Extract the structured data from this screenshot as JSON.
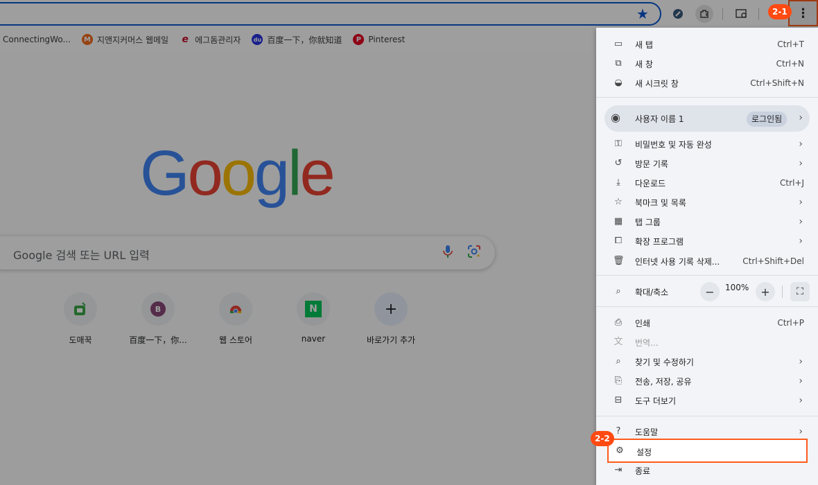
{
  "toolbar": {
    "menu_icon": "more-vert-icon"
  },
  "bookmarks": [
    {
      "label": "ConnectingWo...",
      "icon": "",
      "color": ""
    },
    {
      "label": "지앤지커머스 웹메일",
      "icon": "M",
      "color": "#f26b1d"
    },
    {
      "label": "에그돔관리자",
      "icon": "e",
      "color": "#c8102e"
    },
    {
      "label": "百度一下，你就知道",
      "icon": "du",
      "color": "#2932e1"
    },
    {
      "label": "Pinterest",
      "icon": "P",
      "color": "#e60023"
    }
  ],
  "google": {
    "logo": "Google",
    "logo_colors": [
      "#4285f4",
      "#ea4335",
      "#fbbc05",
      "#4285f4",
      "#34a853",
      "#ea4335"
    ],
    "search_placeholder": "Google 검색 또는 URL 입력"
  },
  "shortcuts": [
    {
      "label": "도매꾹",
      "icon": "domeggook-icon"
    },
    {
      "label": "百度一下，你...",
      "icon": "B"
    },
    {
      "label": "웹 스토어",
      "icon": "chrome-webstore-icon"
    },
    {
      "label": "naver",
      "icon": "N"
    },
    {
      "label": "바로가기 추가",
      "icon": "+"
    }
  ],
  "menu": {
    "new_tab": {
      "label": "새 탭",
      "shortcut": "Ctrl+T"
    },
    "new_window": {
      "label": "새 창",
      "shortcut": "Ctrl+N"
    },
    "incognito": {
      "label": "새 시크릿 창",
      "shortcut": "Ctrl+Shift+N"
    },
    "profile": {
      "label": "사용자 이름 1",
      "badge": "로그인됨"
    },
    "passwords": {
      "label": "비밀번호 및 자동 완성"
    },
    "history": {
      "label": "방문 기록"
    },
    "downloads": {
      "label": "다운로드",
      "shortcut": "Ctrl+J"
    },
    "bookmarks": {
      "label": "북마크 및 목록"
    },
    "tab_groups": {
      "label": "탭 그룹"
    },
    "extensions": {
      "label": "확장 프로그램"
    },
    "clear_data": {
      "label": "인터넷 사용 기록 삭제...",
      "shortcut": "Ctrl+Shift+Del"
    },
    "zoom": {
      "label": "확대/축소",
      "value": "100%",
      "minus": "−",
      "plus": "+"
    },
    "print": {
      "label": "인쇄",
      "shortcut": "Ctrl+P"
    },
    "translate": {
      "label": "번역..."
    },
    "find_edit": {
      "label": "찾기 및 수정하기"
    },
    "cast_save_share": {
      "label": "전송, 저장, 공유"
    },
    "more_tools": {
      "label": "도구 더보기"
    },
    "help": {
      "label": "도움말"
    },
    "settings": {
      "label": "설정"
    },
    "exit": {
      "label": "종료"
    }
  },
  "annotations": {
    "step_2_1": "2-1",
    "step_2_2": "2-2",
    "color": "#ff4a12"
  }
}
